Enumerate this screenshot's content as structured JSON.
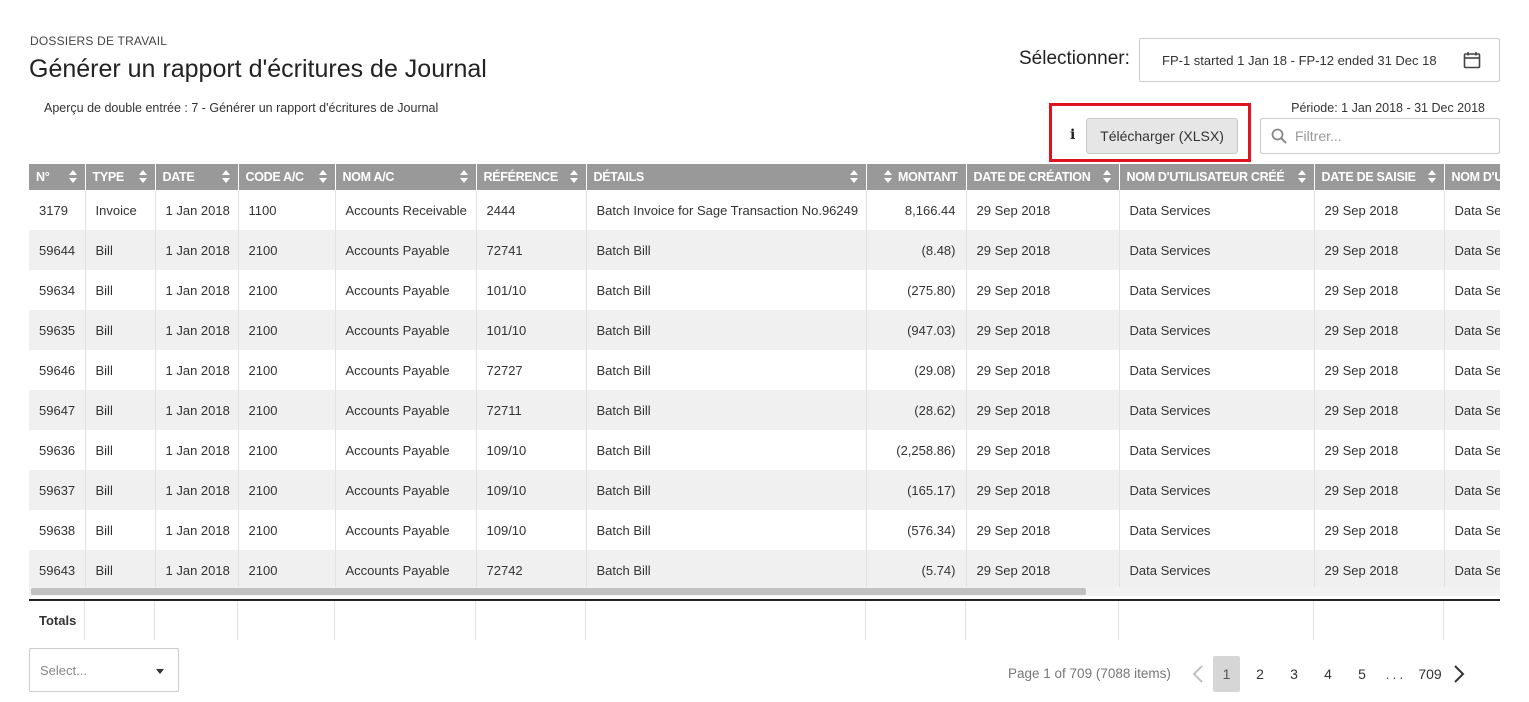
{
  "breadcrumb": "DOSSIERS DE TRAVAIL",
  "title": "Générer un rapport d'écritures de Journal",
  "subtitle": "Aperçu de double entrée : 7 - Générer un rapport d'écritures de Journal",
  "selector": {
    "label": "Sélectionner:",
    "value": "FP-1 started 1 Jan 18 - FP-12 ended 31 Dec 18"
  },
  "period": "Période: 1 Jan 2018 - 31 Dec 2018",
  "toolbar": {
    "info": "i",
    "download_label": "Télécharger (XLSX)",
    "filter_placeholder": "Filtrer..."
  },
  "colors": {
    "header_bg": "#999999",
    "highlight": "#e0141e",
    "row_alt": "#f0f0f0"
  },
  "table": {
    "columns": [
      "N°",
      "TYPE",
      "DATE",
      "CODE A/C",
      "NOM A/C",
      "RÉFÉRENCE",
      "DÉTAILS",
      "MONTANT",
      "DATE DE CRÉATION",
      "NOM D'UTILISATEUR CRÉÉ",
      "DATE DE SAISIE",
      "NOM D'U"
    ],
    "rows": [
      [
        "3179",
        "Invoice",
        "1 Jan 2018",
        "1100",
        "Accounts Receivable",
        "2444",
        "Batch Invoice for Sage Transaction No.96249",
        "8,166.44",
        "29 Sep 2018",
        "Data Services",
        "29 Sep 2018",
        "Data Se"
      ],
      [
        "59644",
        "Bill",
        "1 Jan 2018",
        "2100",
        "Accounts Payable",
        "72741",
        "Batch Bill",
        "(8.48)",
        "29 Sep 2018",
        "Data Services",
        "29 Sep 2018",
        "Data Se"
      ],
      [
        "59634",
        "Bill",
        "1 Jan 2018",
        "2100",
        "Accounts Payable",
        "101/10",
        "Batch Bill",
        "(275.80)",
        "29 Sep 2018",
        "Data Services",
        "29 Sep 2018",
        "Data Se"
      ],
      [
        "59635",
        "Bill",
        "1 Jan 2018",
        "2100",
        "Accounts Payable",
        "101/10",
        "Batch Bill",
        "(947.03)",
        "29 Sep 2018",
        "Data Services",
        "29 Sep 2018",
        "Data Se"
      ],
      [
        "59646",
        "Bill",
        "1 Jan 2018",
        "2100",
        "Accounts Payable",
        "72727",
        "Batch Bill",
        "(29.08)",
        "29 Sep 2018",
        "Data Services",
        "29 Sep 2018",
        "Data Se"
      ],
      [
        "59647",
        "Bill",
        "1 Jan 2018",
        "2100",
        "Accounts Payable",
        "72711",
        "Batch Bill",
        "(28.62)",
        "29 Sep 2018",
        "Data Services",
        "29 Sep 2018",
        "Data Se"
      ],
      [
        "59636",
        "Bill",
        "1 Jan 2018",
        "2100",
        "Accounts Payable",
        "109/10",
        "Batch Bill",
        "(2,258.86)",
        "29 Sep 2018",
        "Data Services",
        "29 Sep 2018",
        "Data Se"
      ],
      [
        "59637",
        "Bill",
        "1 Jan 2018",
        "2100",
        "Accounts Payable",
        "109/10",
        "Batch Bill",
        "(165.17)",
        "29 Sep 2018",
        "Data Services",
        "29 Sep 2018",
        "Data Se"
      ],
      [
        "59638",
        "Bill",
        "1 Jan 2018",
        "2100",
        "Accounts Payable",
        "109/10",
        "Batch Bill",
        "(576.34)",
        "29 Sep 2018",
        "Data Services",
        "29 Sep 2018",
        "Data Se"
      ],
      [
        "59643",
        "Bill",
        "1 Jan 2018",
        "2100",
        "Accounts Payable",
        "72742",
        "Batch Bill",
        "(5.74)",
        "29 Sep 2018",
        "Data Services",
        "29 Sep 2018",
        "Data Se"
      ]
    ],
    "totals_label": "Totals"
  },
  "footer": {
    "page_size_placeholder": "Select...",
    "pager_info": "Page 1 of 709 (7088 items)",
    "pages": [
      "1",
      "2",
      "3",
      "4",
      "5",
      "...",
      "709"
    ],
    "current_page": "1"
  }
}
